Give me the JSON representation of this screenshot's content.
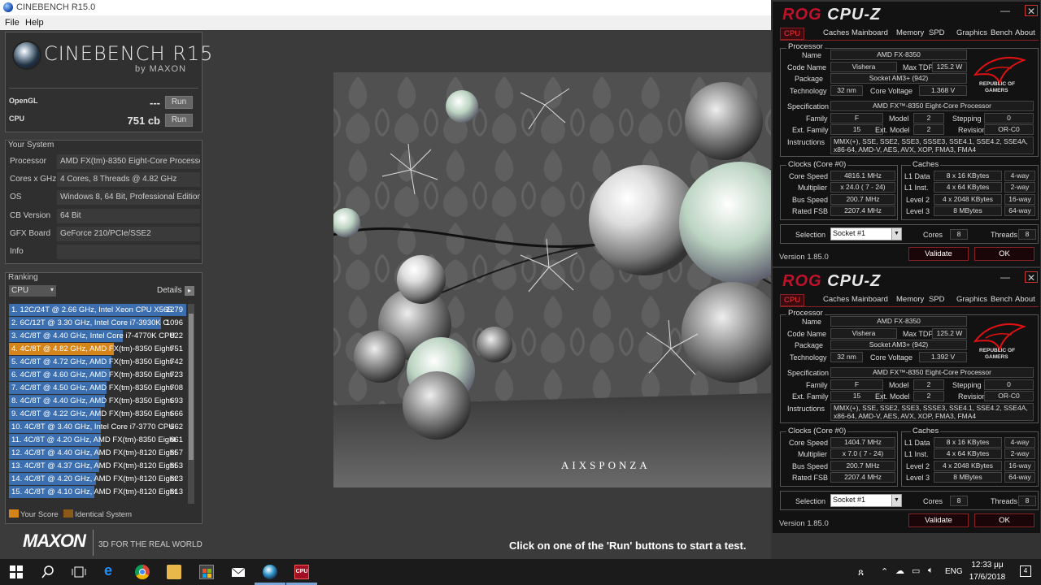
{
  "cinebench": {
    "window_title": "CINEBENCH R15.0",
    "menu": [
      "File",
      "Help"
    ],
    "logo": {
      "name": "CINEBENCH R15",
      "by": "by MAXON"
    },
    "scores": [
      {
        "label": "OpenGL",
        "value": "---",
        "button": "Run"
      },
      {
        "label": "CPU",
        "value": "751 cb",
        "button": "Run"
      }
    ],
    "your_system": {
      "title": "Your System",
      "rows": [
        {
          "key": "Processor",
          "value": "AMD FX(tm)-8350 Eight-Core Processor"
        },
        {
          "key": "Cores x GHz",
          "value": "4 Cores, 8 Threads @ 4.82 GHz"
        },
        {
          "key": "OS",
          "value": "Windows 8, 64 Bit, Professional Edition ("
        },
        {
          "key": "CB Version",
          "value": "64 Bit"
        },
        {
          "key": "GFX Board",
          "value": "GeForce 210/PCIe/SSE2"
        },
        {
          "key": "Info",
          "value": ""
        }
      ]
    },
    "ranking": {
      "title": "Ranking",
      "select": "CPU",
      "details": "Details",
      "rows": [
        {
          "text": "1. 12C/24T @ 2.66 GHz, Intel Xeon CPU X565",
          "score": "1279",
          "frac": 1.0,
          "mine": false
        },
        {
          "text": "2. 6C/12T @ 3.30 GHz,  Intel Core i7-3930K C",
          "score": "1096",
          "frac": 0.86,
          "mine": false
        },
        {
          "text": "3. 4C/8T @ 4.40 GHz, Intel Core i7-4770K CPU",
          "score": "822",
          "frac": 0.64,
          "mine": false
        },
        {
          "text": "4. 4C/8T @ 4.82 GHz, AMD FX(tm)-8350 Eight-",
          "score": "751",
          "frac": 0.59,
          "mine": true
        },
        {
          "text": "5. 4C/8T @ 4.72 GHz, AMD FX(tm)-8350 Eight-",
          "score": "742",
          "frac": 0.58,
          "mine": false
        },
        {
          "text": "6. 4C/8T @ 4.60 GHz, AMD FX(tm)-8350 Eight-",
          "score": "723",
          "frac": 0.57,
          "mine": false
        },
        {
          "text": "7. 4C/8T @ 4.50 GHz, AMD FX(tm)-8350 Eight-",
          "score": "708",
          "frac": 0.55,
          "mine": false
        },
        {
          "text": "8. 4C/8T @ 4.40 GHz, AMD FX(tm)-8350 Eight-",
          "score": "693",
          "frac": 0.54,
          "mine": false
        },
        {
          "text": "9. 4C/8T @ 4.22 GHz, AMD FX(tm)-8350 Eight-",
          "score": "666",
          "frac": 0.52,
          "mine": false
        },
        {
          "text": "10. 4C/8T @ 3.40 GHz,  Intel Core i7-3770 CPU",
          "score": "662",
          "frac": 0.52,
          "mine": false
        },
        {
          "text": "11. 4C/8T @ 4.20 GHz, AMD FX(tm)-8350 Eight",
          "score": "661",
          "frac": 0.52,
          "mine": false
        },
        {
          "text": "12. 4C/8T @ 4.40 GHz, AMD FX(tm)-8120 Eight",
          "score": "657",
          "frac": 0.51,
          "mine": false
        },
        {
          "text": "13. 4C/8T @ 4.37 GHz, AMD FX(tm)-8120 Eight",
          "score": "653",
          "frac": 0.51,
          "mine": false
        },
        {
          "text": "14. 4C/8T @ 4.20 GHz, AMD FX(tm)-8120 Eight",
          "score": "623",
          "frac": 0.49,
          "mine": false
        },
        {
          "text": "15. 4C/8T @ 4.10 GHz, AMD FX(tm)-8120 Eight",
          "score": "613",
          "frac": 0.48,
          "mine": false
        }
      ],
      "legend_your": "Your Score",
      "legend_identical": "Identical System"
    },
    "footer": {
      "brand": "MAXON",
      "tagline": "3D FOR THE REAL WORLD"
    },
    "render_watermark": "AIXSPONZA",
    "status": "Click on one of the 'Run' buttons to start a test."
  },
  "cpuz_windows": [
    {
      "title_a": "ROG",
      "title_b": "CPU-Z",
      "tabs": [
        "CPU",
        "Caches",
        "Mainboard",
        "Memory",
        "SPD",
        "Graphics",
        "Bench",
        "About"
      ],
      "processor_title": "Processor",
      "name": "AMD FX-8350",
      "code_name": "Vishera",
      "max_tdp": "125.2 W",
      "package": "Socket AM3+ (942)",
      "technology": "32 nm",
      "core_voltage": "1.368 V",
      "specification": "AMD FX™-8350 Eight-Core Processor",
      "family": "F",
      "model": "2",
      "stepping": "0",
      "ext_family": "15",
      "ext_model": "2",
      "revision": "OR-C0",
      "instructions": "MMX(+), SSE, SSE2, SSE3, SSSE3, SSE4.1, SSE4.2, SSE4A, x86-64, AMD-V, AES, AVX, XOP, FMA3, FMA4",
      "clocks_title": "Clocks (Core #0)",
      "core_speed": "4816.1 MHz",
      "multiplier": "x 24.0 ( 7 - 24)",
      "bus_speed": "200.7 MHz",
      "rated_fsb": "2207.4 MHz",
      "caches_title": "Caches",
      "l1d": "8 x 16 KBytes",
      "l1d_way": "4-way",
      "l1i": "4 x 64 KBytes",
      "l1i_way": "2-way",
      "l2": "4 x 2048 KBytes",
      "l2_way": "16-way",
      "l3": "8 MBytes",
      "l3_way": "64-way",
      "selection": "Socket #1",
      "cores": "8",
      "threads": "8",
      "version": "Version 1.85.0",
      "validate": "Validate",
      "ok": "OK",
      "labels": {
        "name": "Name",
        "code_name": "Code Name",
        "max_tdp": "Max TDP",
        "package": "Package",
        "technology": "Technology",
        "core_voltage": "Core Voltage",
        "specification": "Specification",
        "family": "Family",
        "model": "Model",
        "stepping": "Stepping",
        "ext_family": "Ext. Family",
        "ext_model": "Ext. Model",
        "revision": "Revision",
        "instructions": "Instructions",
        "core_speed": "Core Speed",
        "multiplier": "Multiplier",
        "bus_speed": "Bus Speed",
        "rated_fsb": "Rated FSB",
        "l1d": "L1 Data",
        "l1i": "L1 Inst.",
        "l2": "Level 2",
        "l3": "Level 3",
        "selection": "Selection",
        "cores": "Cores",
        "threads": "Threads",
        "rog1": "REPUBLIC OF",
        "rog2": "GAMERS"
      }
    },
    {
      "title_a": "ROG",
      "title_b": "CPU-Z",
      "tabs": [
        "CPU",
        "Caches",
        "Mainboard",
        "Memory",
        "SPD",
        "Graphics",
        "Bench",
        "About"
      ],
      "processor_title": "Processor",
      "name": "AMD FX-8350",
      "code_name": "Vishera",
      "max_tdp": "125.2 W",
      "package": "Socket AM3+ (942)",
      "technology": "32 nm",
      "core_voltage": "1.392 V",
      "specification": "AMD FX™-8350 Eight-Core Processor",
      "family": "F",
      "model": "2",
      "stepping": "0",
      "ext_family": "15",
      "ext_model": "2",
      "revision": "OR-C0",
      "instructions": "MMX(+), SSE, SSE2, SSE3, SSSE3, SSE4.1, SSE4.2, SSE4A, x86-64, AMD-V, AES, AVX, XOP, FMA3, FMA4",
      "clocks_title": "Clocks (Core #0)",
      "core_speed": "1404.7 MHz",
      "multiplier": "x 7.0 ( 7 - 24)",
      "bus_speed": "200.7 MHz",
      "rated_fsb": "2207.4 MHz",
      "caches_title": "Caches",
      "l1d": "8 x 16 KBytes",
      "l1d_way": "4-way",
      "l1i": "4 x 64 KBytes",
      "l1i_way": "2-way",
      "l2": "4 x 2048 KBytes",
      "l2_way": "16-way",
      "l3": "8 MBytes",
      "l3_way": "64-way",
      "selection": "Socket #1",
      "cores": "8",
      "threads": "8",
      "version": "Version 1.85.0",
      "validate": "Validate",
      "ok": "OK",
      "labels": {
        "name": "Name",
        "code_name": "Code Name",
        "max_tdp": "Max TDP",
        "package": "Package",
        "technology": "Technology",
        "core_voltage": "Core Voltage",
        "specification": "Specification",
        "family": "Family",
        "model": "Model",
        "stepping": "Stepping",
        "ext_family": "Ext. Family",
        "ext_model": "Ext. Model",
        "revision": "Revision",
        "instructions": "Instructions",
        "core_speed": "Core Speed",
        "multiplier": "Multiplier",
        "bus_speed": "Bus Speed",
        "rated_fsb": "Rated FSB",
        "l1d": "L1 Data",
        "l1i": "L1 Inst.",
        "l2": "Level 2",
        "l3": "Level 3",
        "selection": "Selection",
        "cores": "Cores",
        "threads": "Threads",
        "rog1": "REPUBLIC OF",
        "rog2": "GAMERS"
      }
    }
  ],
  "taskbar": {
    "language": "ENG",
    "time": "12:33 μμ",
    "date": "17/6/2018",
    "notifications": "4"
  }
}
